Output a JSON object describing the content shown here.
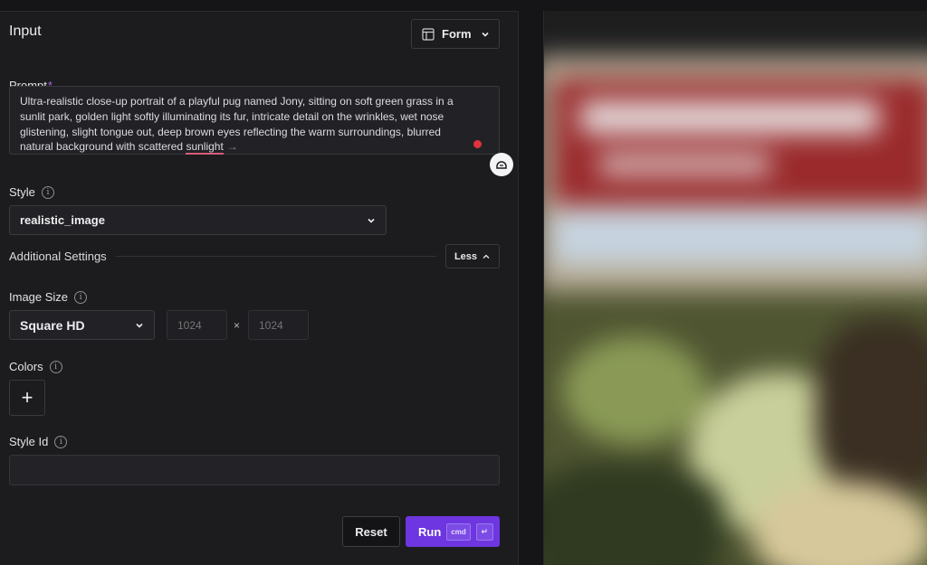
{
  "input_panel": {
    "title": "Input",
    "view_toggle": {
      "label": "Form",
      "icon": "layout-icon"
    },
    "prompt": {
      "label": "Prompt",
      "required_mark": "*",
      "value_main": "Ultra-realistic close-up portrait of a playful pug named Jony, sitting on soft green grass in a sunlit park, golden light softly illuminating its fur, intricate detail on the wrinkles, wet nose glistening, slight tongue out, deep brown eyes reflecting the warm surroundings, blurred natural background with scattered ",
      "value_flagged_word": "sunlight",
      "suggestion_arrow": "→"
    },
    "style": {
      "label": "Style",
      "value": "realistic_image"
    },
    "additional_settings": {
      "label": "Additional Settings",
      "toggle_label": "Less"
    },
    "image_size": {
      "label": "Image Size",
      "preset": "Square HD",
      "width_placeholder": "1024",
      "height_placeholder": "1024",
      "separator": "×"
    },
    "colors": {
      "label": "Colors",
      "add_symbol": "+"
    },
    "style_id": {
      "label": "Style Id",
      "value": ""
    },
    "actions": {
      "reset": "Reset",
      "run": "Run",
      "shortcut_modifier": "cmd",
      "shortcut_key": "↵"
    }
  },
  "colors": {
    "accent": "#6d36e0",
    "required": "#a06bd8",
    "spellcheck": "#d95b7a",
    "alert_dot": "#e0333f"
  }
}
